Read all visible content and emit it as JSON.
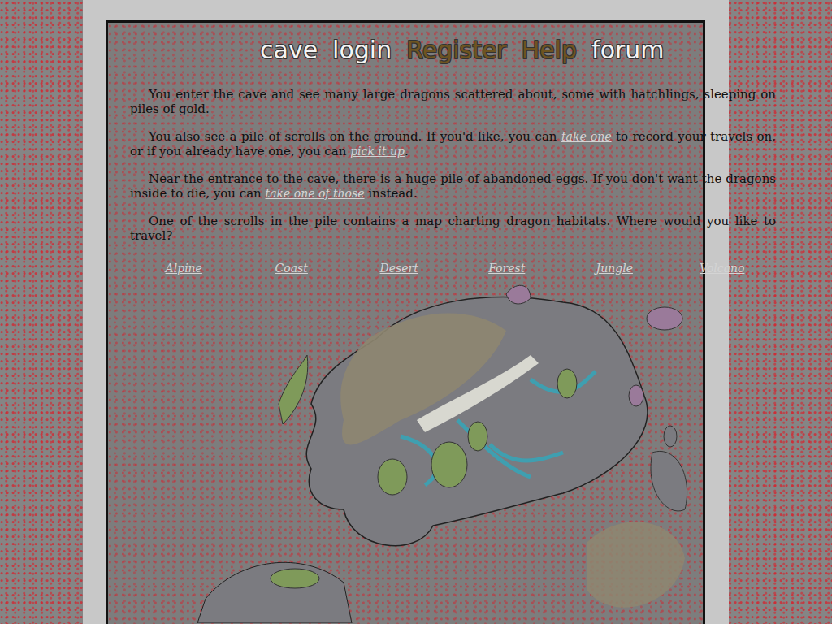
{
  "nav": [
    {
      "label": "cave",
      "color": "#f4f4f4"
    },
    {
      "label": "login",
      "color": "#f4f4f4"
    },
    {
      "label": "Register",
      "color": "#6e5420"
    },
    {
      "label": "Help",
      "color": "#6e5420"
    },
    {
      "label": "forum",
      "color": "#f4f4f4"
    }
  ],
  "paragraphs": [
    [
      {
        "text": "You enter the cave and see many large dragons scattered about, some with hatchlings, sleeping on piles of gold.",
        "link": false
      }
    ],
    [
      {
        "text": "You also see a pile of scrolls on the ground. If you'd like, you can ",
        "link": false
      },
      {
        "text": "take one",
        "link": true
      },
      {
        "text": " to record your travels on, or if you already have one, you can ",
        "link": false
      },
      {
        "text": "pick it up",
        "link": true
      },
      {
        "text": ".",
        "link": false
      }
    ],
    [
      {
        "text": "Near the entrance to the cave, there is a huge pile of abandoned eggs. If you don't want the dragons inside to die, you can ",
        "link": false
      },
      {
        "text": "take one of those",
        "link": true
      },
      {
        "text": " instead.",
        "link": false
      }
    ],
    [
      {
        "text": "One of the scrolls in the pile contains a map charting dragon habitats. Where would you like to travel?",
        "link": false
      }
    ]
  ],
  "habitats": [
    "Alpine",
    "Coast",
    "Desert",
    "Forest",
    "Jungle",
    "Volcano"
  ]
}
